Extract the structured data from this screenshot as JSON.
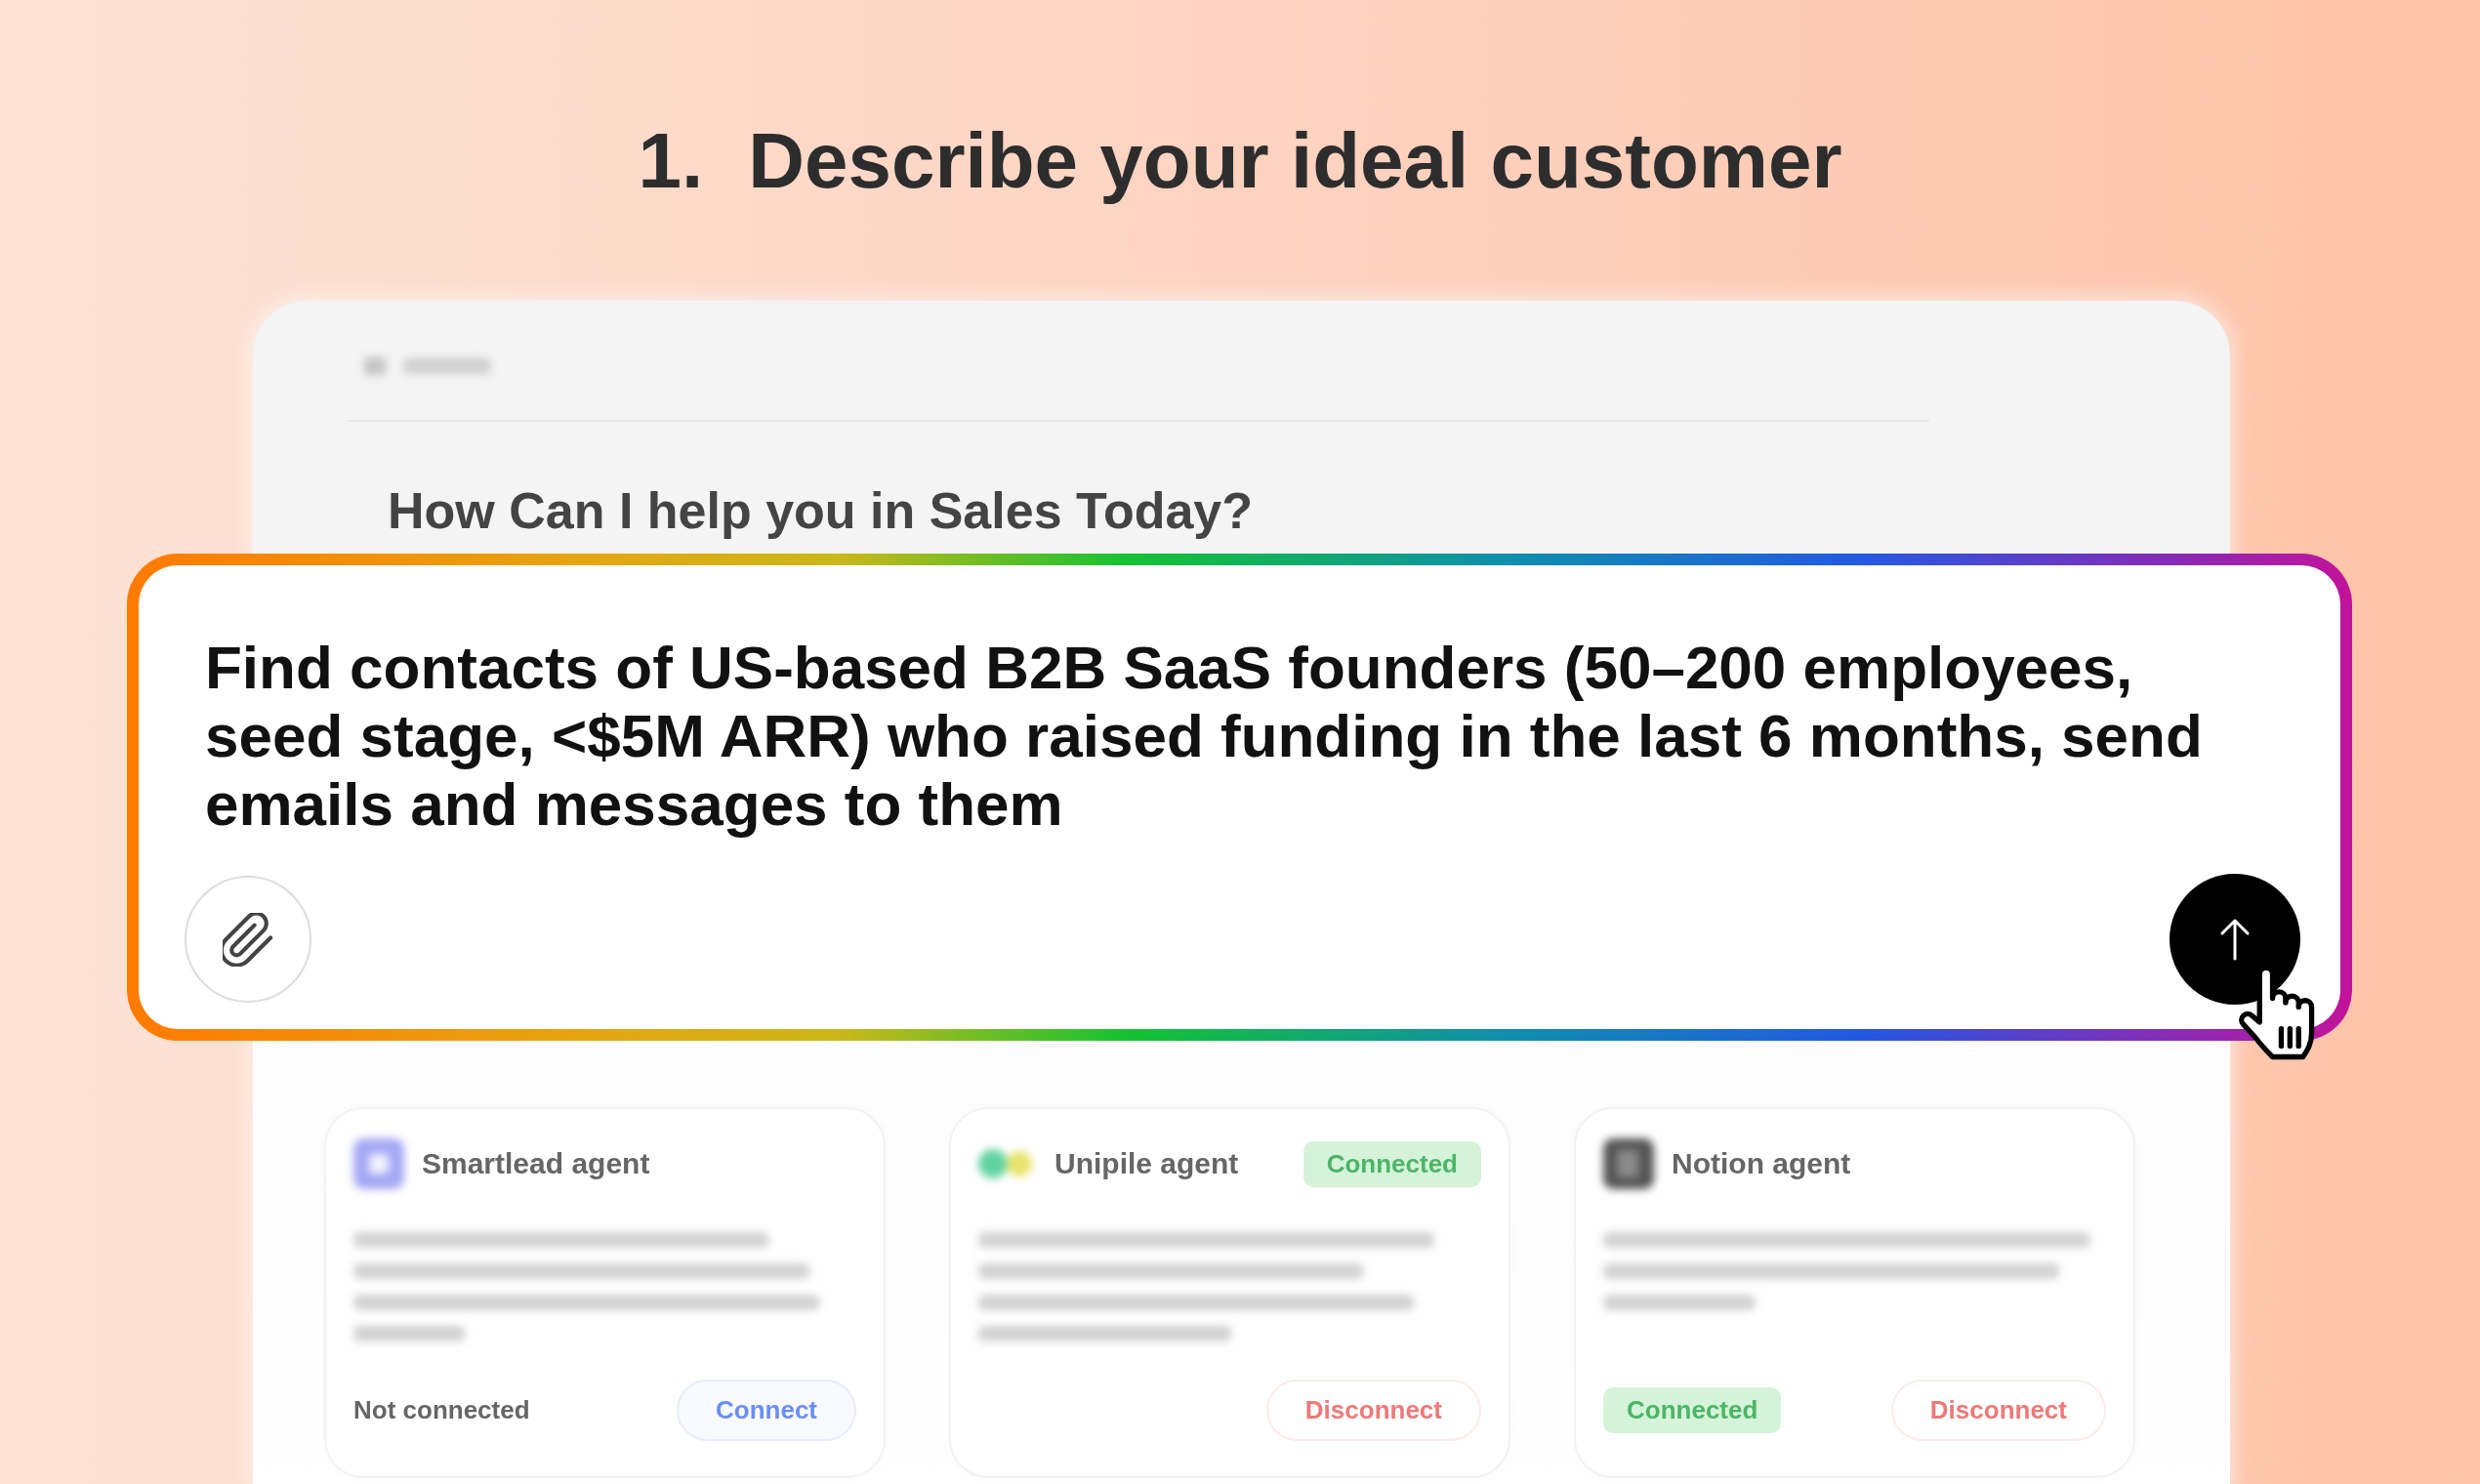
{
  "heading": {
    "step_number": "1.",
    "title": "Describe your ideal customer"
  },
  "background_app": {
    "heading": "How Can I help you in Sales Today?",
    "agents": [
      {
        "name": "Smartlead agent",
        "connected": false,
        "status": "Not connected",
        "status_in_header": false,
        "action": "Connect"
      },
      {
        "name": "Unipile agent",
        "connected": true,
        "status": "Connected",
        "status_in_header": true,
        "action": "Disconnect"
      },
      {
        "name": "Notion agent",
        "connected": true,
        "status": "Connected",
        "status_in_header": false,
        "action": "Disconnect"
      }
    ]
  },
  "prompt": {
    "value": "Find contacts of US-based B2B SaaS founders (50–200 employees, seed stage, <$5M ARR) who raised funding in the last 6 months, send emails and messages to them"
  }
}
